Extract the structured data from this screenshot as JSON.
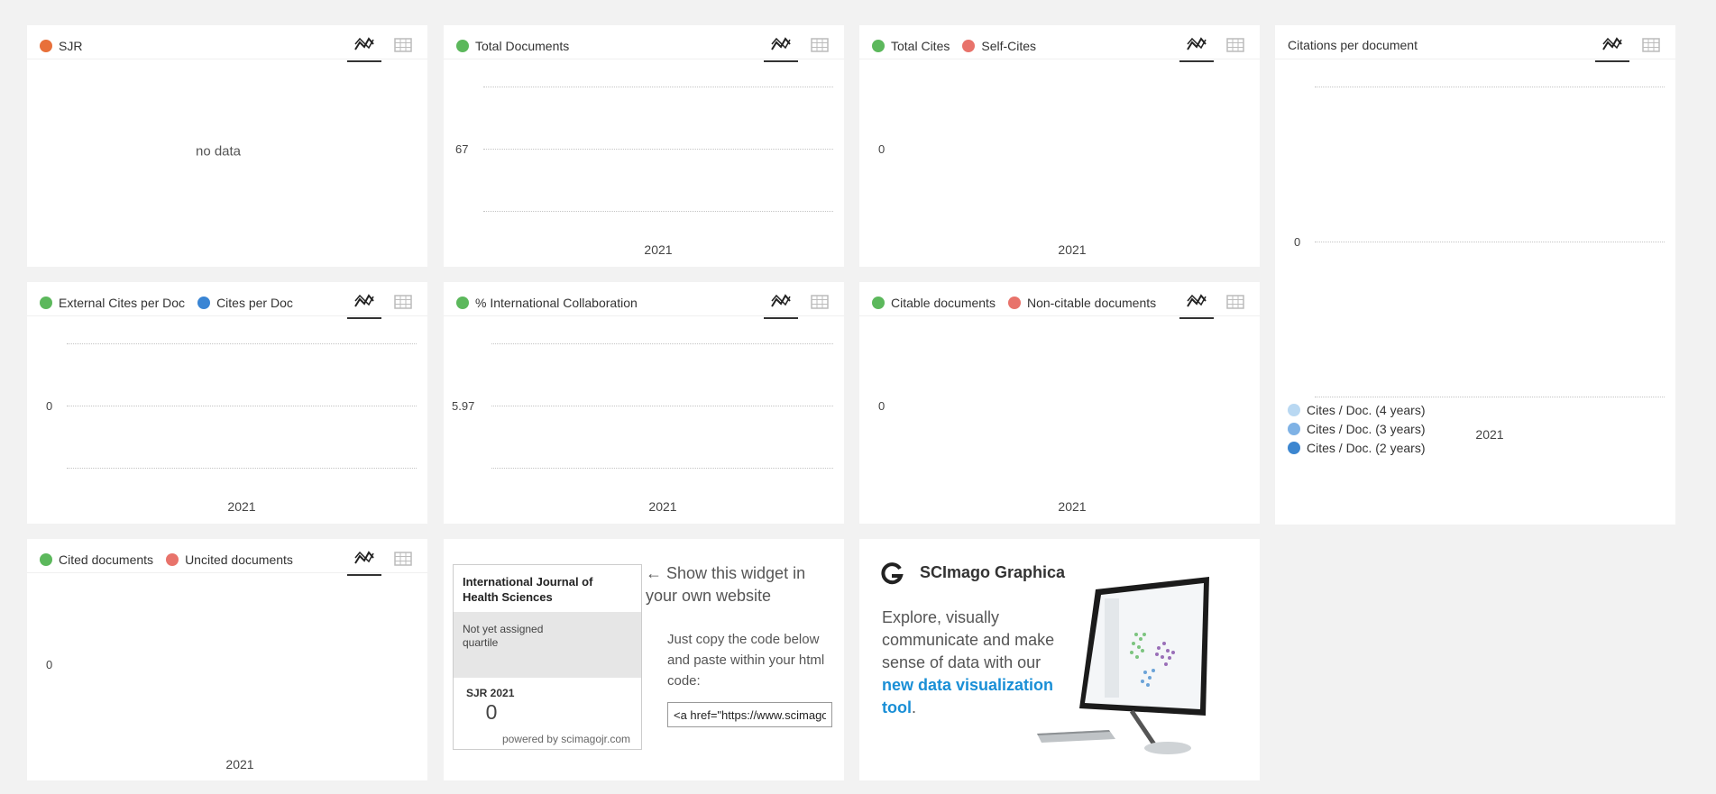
{
  "colors": {
    "orange": "#e8703a",
    "green": "#5cb85c",
    "red": "#e8736b",
    "blue": "#3a85d4",
    "lightblue1": "#b9d8f2",
    "lightblue2": "#7fb2e5",
    "darkblue": "#3c86d0",
    "link": "#1a8fd6"
  },
  "icons": {
    "chart": "line-chart-icon",
    "table": "table-icon"
  },
  "sjr": {
    "legend": [
      "SJR"
    ],
    "nodata": "no data"
  },
  "total_docs": {
    "legend": [
      "Total Documents"
    ],
    "ytick": "67",
    "xtick": "2021"
  },
  "total_cites": {
    "legend": [
      "Total Cites",
      "Self-Cites"
    ],
    "ytick": "0",
    "xtick": "2021"
  },
  "cites_per_doc": {
    "title": "Citations per document",
    "ytick": "0",
    "xtick": "2021",
    "legend": [
      "Cites / Doc. (4 years)",
      "Cites / Doc. (3 years)",
      "Cites / Doc. (2 years)"
    ]
  },
  "external_cites": {
    "legend": [
      "External Cites per Doc",
      "Cites per Doc"
    ],
    "ytick": "0",
    "xtick": "2021"
  },
  "intl_collab": {
    "legend": [
      "% International Collaboration"
    ],
    "ytick": "5.97",
    "xtick": "2021"
  },
  "citable": {
    "legend": [
      "Citable documents",
      "Non-citable documents"
    ],
    "ytick": "0",
    "xtick": "2021"
  },
  "cited": {
    "legend": [
      "Cited documents",
      "Uncited documents"
    ],
    "ytick": "0",
    "xtick": "2021"
  },
  "widget": {
    "journal": "International Journal of Health Sciences",
    "quartile": "Not yet assigned quartile",
    "sjr_label": "SJR 2021",
    "sjr_value": "0",
    "powered": "powered by scimagojr.com",
    "arrow_text": "← Show this widget in your own website",
    "copy_text": "Just copy the code below and paste within your html code:",
    "code_value": "<a href=\"https://www.scimagojr.com/journalsearch.php"
  },
  "graphica": {
    "name": "SCImago Graphica",
    "text": "Explore, visually communicate and make sense of data with our",
    "link": "new data visualization tool",
    "period": "."
  }
}
